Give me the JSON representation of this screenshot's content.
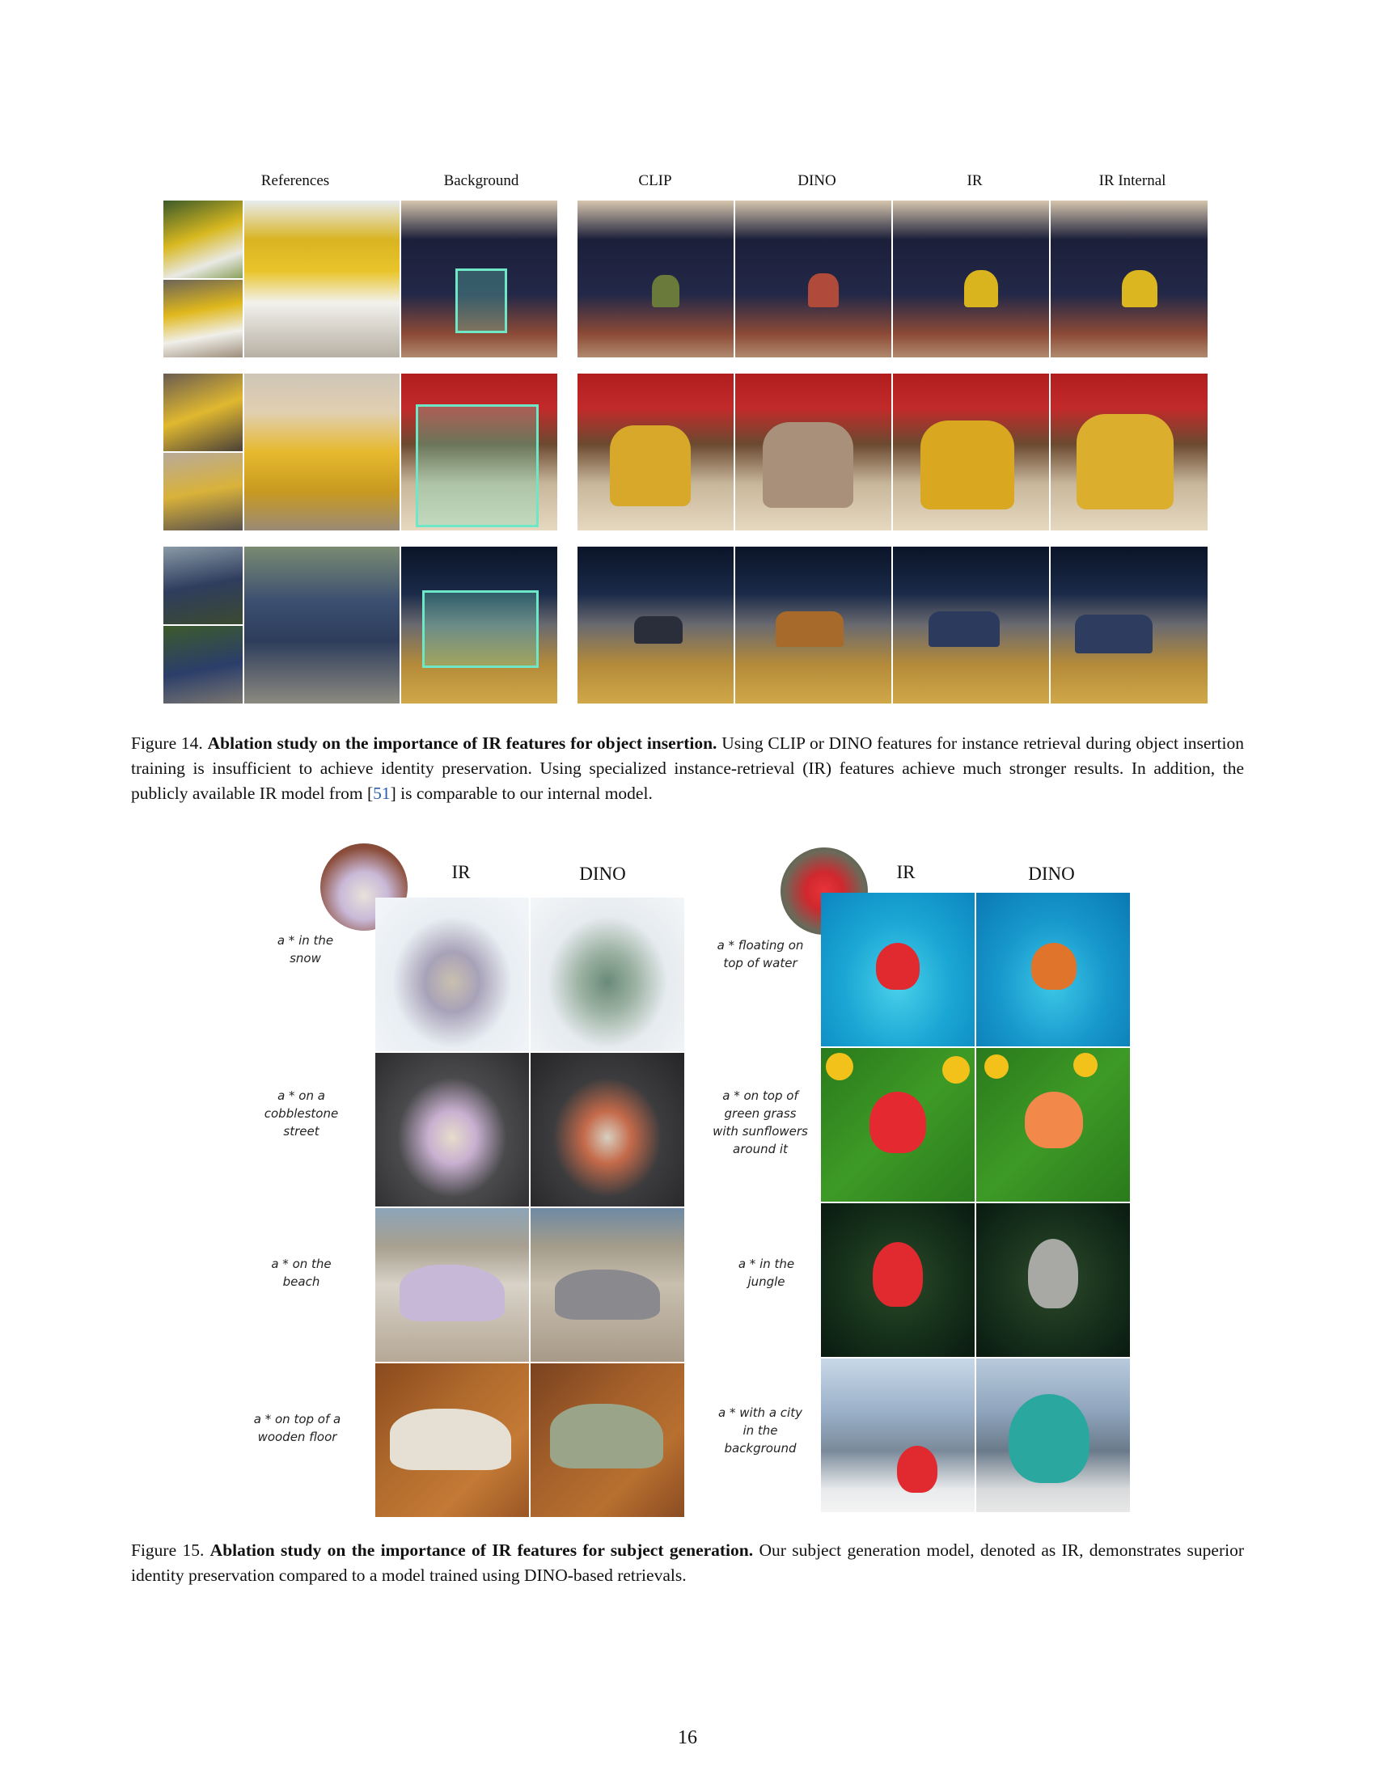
{
  "fig14": {
    "columns": [
      "References",
      "Background",
      "CLIP",
      "DINO",
      "IR",
      "IR Internal"
    ],
    "caption_label": "Figure 14.",
    "caption_title": "Ablation study on the importance of IR features for object insertion.",
    "caption_body_1": " Using CLIP or DINO features for instance retrieval during object insertion training is insufficient to achieve identity preservation. Using specialized instance-retrieval (IR) features achieve much stronger results. In addition, the publicly available IR model from [",
    "caption_cite": "51",
    "caption_body_2": "] is comparable to our internal model."
  },
  "fig15": {
    "left_headers": [
      "IR",
      "DINO"
    ],
    "right_headers": [
      "IR",
      "DINO"
    ],
    "left_prompts": [
      "a * in the snow",
      "a * on a cobblestone street",
      "a *  on the beach",
      "a * on top of a wooden floor"
    ],
    "right_prompts": [
      "a * floating on top of water",
      "a * on top of green grass with sunflowers around it",
      "a * in the jungle",
      "a * with a city in the background"
    ],
    "caption_label": "Figure 15.",
    "caption_title": "Ablation study on the importance of IR features for subject generation.",
    "caption_body": " Our subject generation model, denoted as IR, demonstrates superior identity preservation compared to a model trained using DINO-based retrievals."
  },
  "page_number": "16"
}
